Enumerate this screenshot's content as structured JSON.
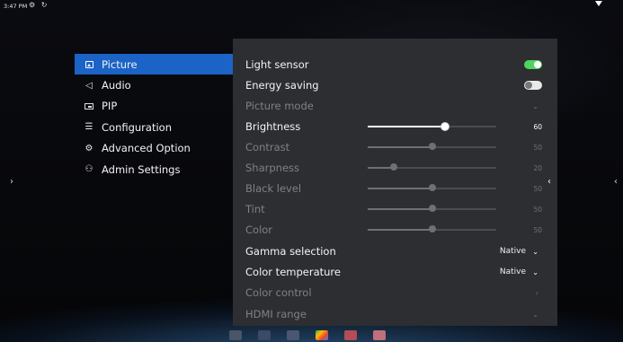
{
  "status_bar": {
    "time": "3:47 PM",
    "icons": "⚙ ↻"
  },
  "side_arrows": {
    "left": "›",
    "right": "‹"
  },
  "sidebar": {
    "items": [
      {
        "label": "Picture",
        "icon": "picture-icon",
        "active": true
      },
      {
        "label": "Audio",
        "icon": "speaker-icon"
      },
      {
        "label": "PIP",
        "icon": "pip-icon"
      },
      {
        "label": "Configuration",
        "icon": "sliders-icon"
      },
      {
        "label": "Advanced Option",
        "icon": "gear-icon"
      },
      {
        "label": "Admin Settings",
        "icon": "admin-user-icon"
      }
    ]
  },
  "panel": {
    "collapse_arrow": "‹",
    "light_sensor": {
      "label": "Light sensor",
      "state": "on"
    },
    "energy_saving": {
      "label": "Energy saving",
      "state": "off"
    },
    "picture_mode": {
      "label": "Picture mode",
      "chevron": "⌄"
    },
    "brightness": {
      "label": "Brightness",
      "value": "60",
      "level": 60
    },
    "contrast": {
      "label": "Contrast",
      "value": "50",
      "level": 50
    },
    "sharpness": {
      "label": "Sharpness",
      "value": "20",
      "level": 20
    },
    "black_level": {
      "label": "Black level",
      "value": "50",
      "level": 50
    },
    "tint": {
      "label": "Tint",
      "value": "50",
      "level": 50
    },
    "color": {
      "label": "Color",
      "value": "50",
      "level": 50
    },
    "gamma": {
      "label": "Gamma selection",
      "value": "Native",
      "chevron": "⌄"
    },
    "color_temperature": {
      "label": "Color temperature",
      "value": "Native",
      "chevron": "⌄"
    },
    "color_control": {
      "label": "Color control",
      "chevron": "›"
    },
    "hdmi_range": {
      "label": "HDMI range",
      "chevron": "⌄"
    }
  },
  "colors": {
    "accent": "#1b63c6",
    "toggle_on": "#4fd35f",
    "panel_bg": "#2c2e31"
  },
  "dock": {
    "icons": [
      "tv-icon",
      "folder-icon",
      "settings-icon",
      "play-store-icon",
      "gift-icon",
      "photo-icon"
    ]
  }
}
